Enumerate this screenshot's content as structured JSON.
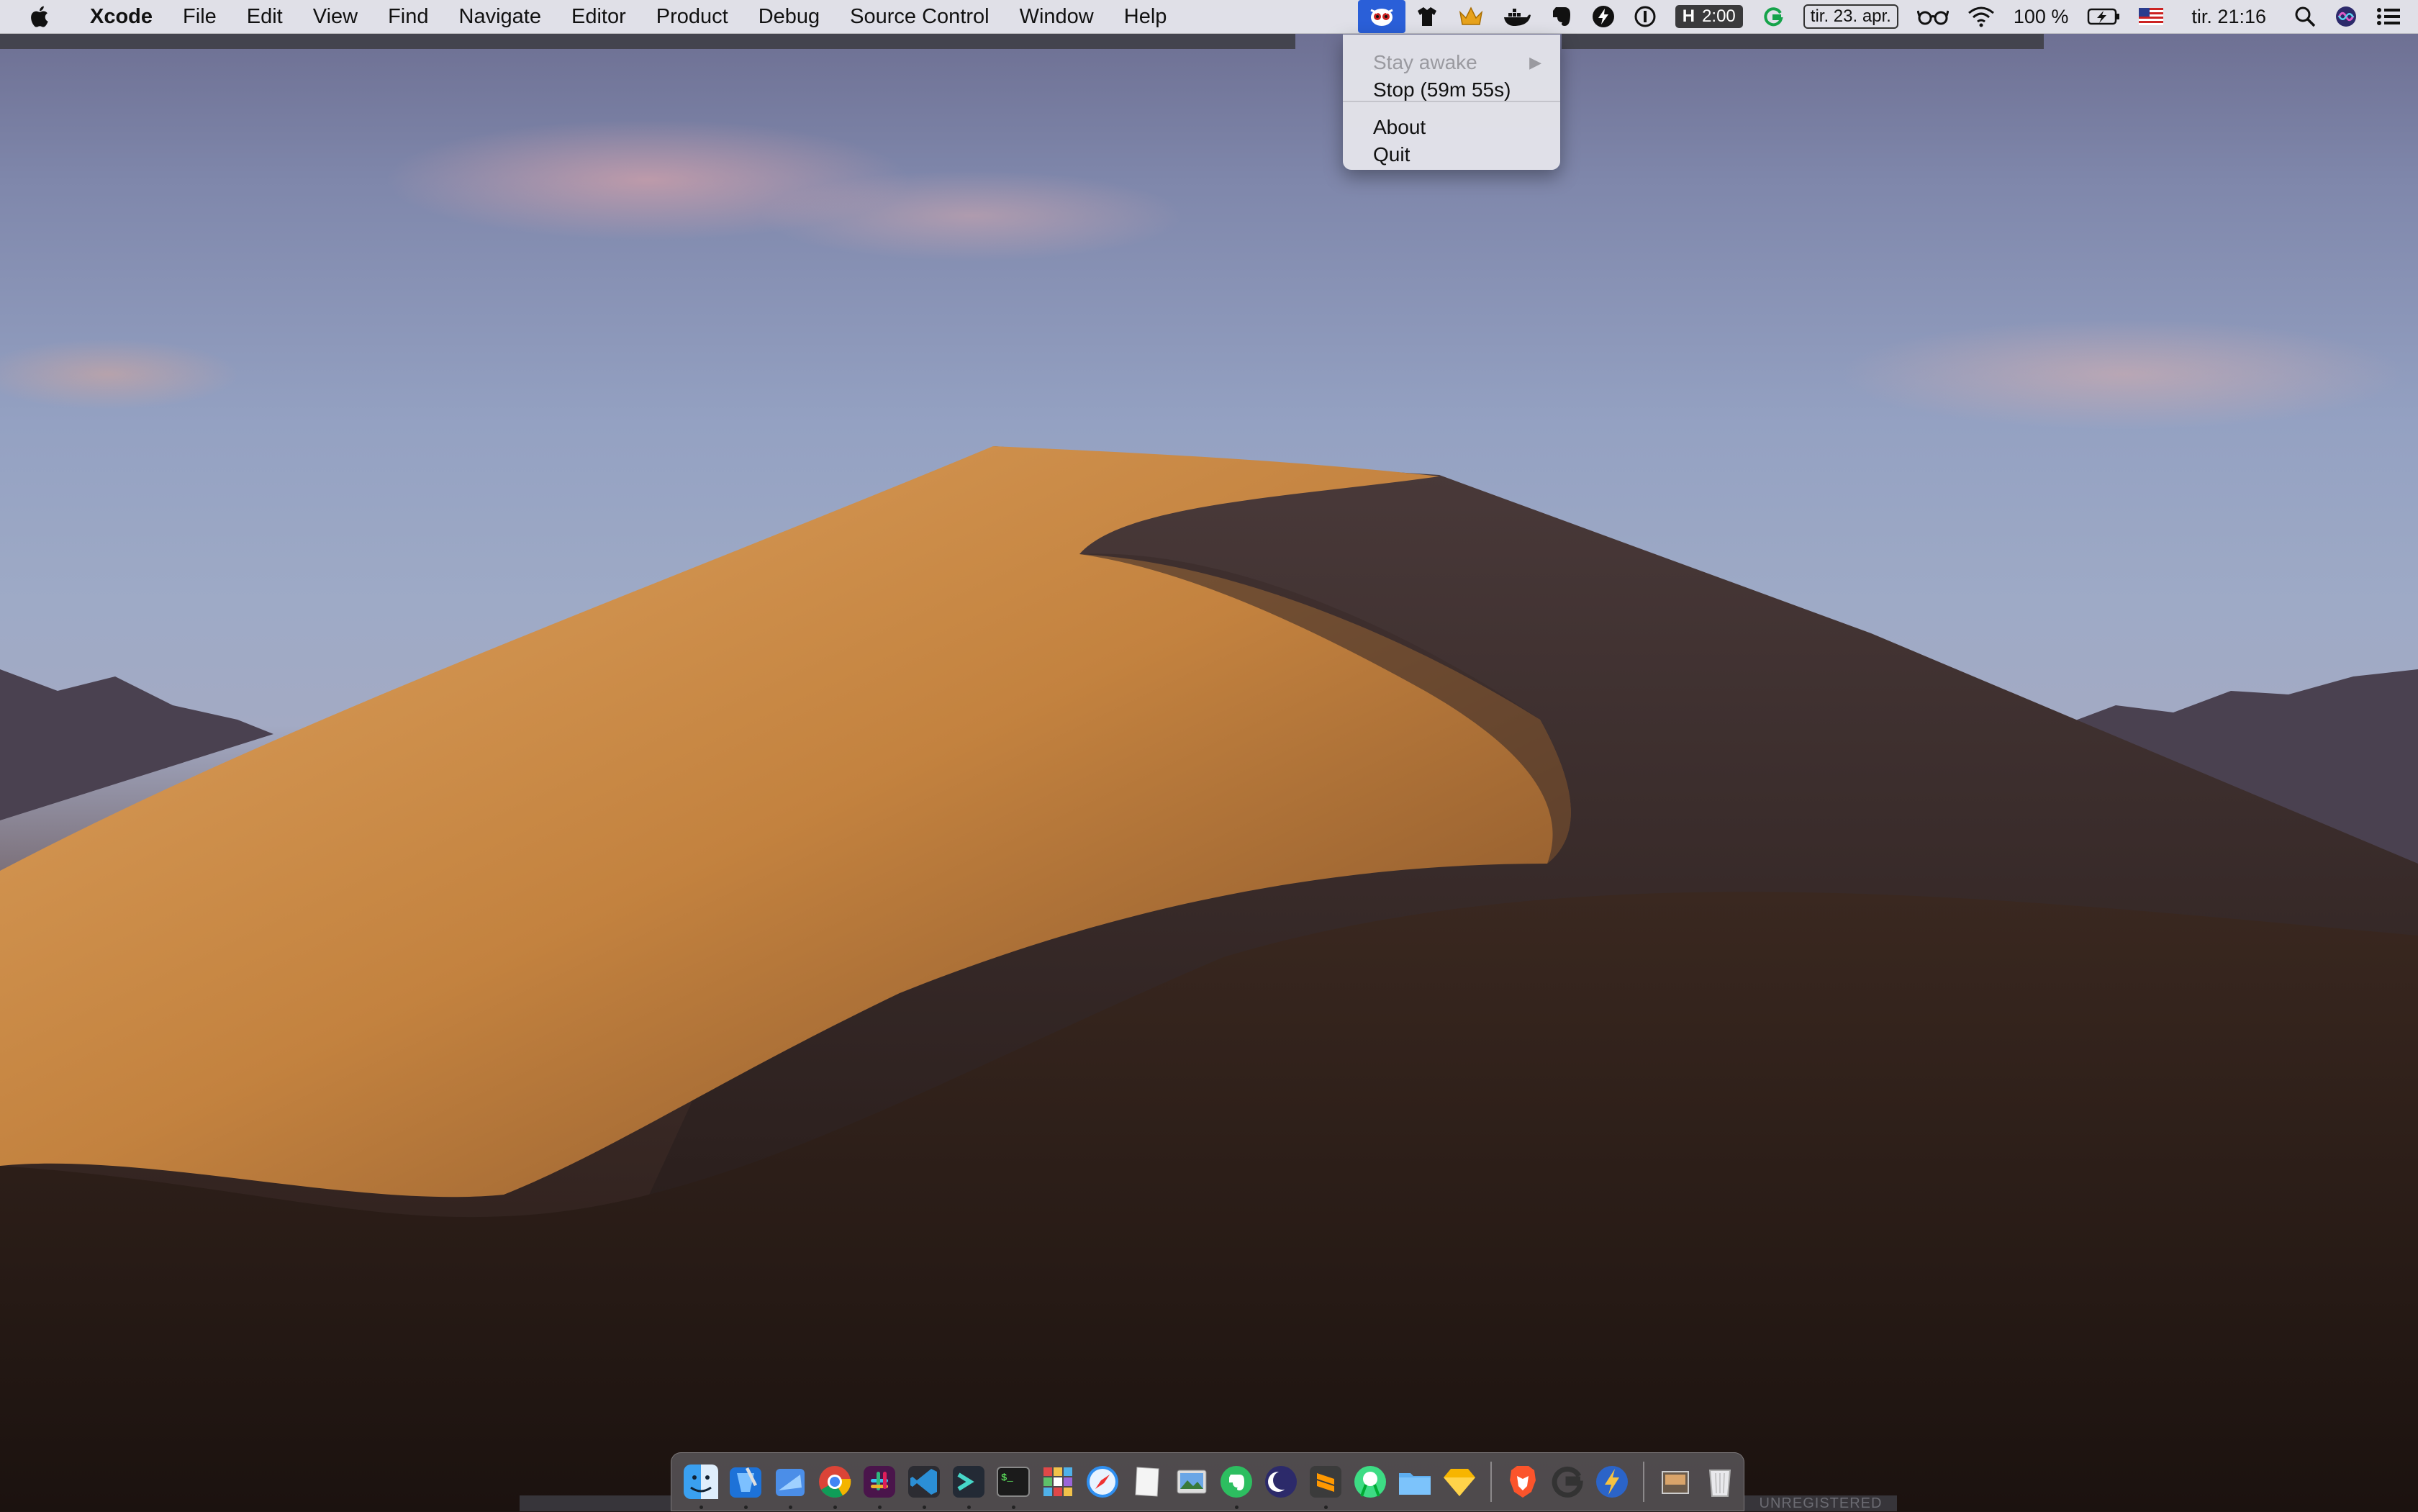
{
  "menubar": {
    "app_name": "Xcode",
    "menus": [
      "File",
      "Edit",
      "View",
      "Find",
      "Navigate",
      "Editor",
      "Product",
      "Debug",
      "Source Control",
      "Window",
      "Help"
    ]
  },
  "status_bar": {
    "timer_badge": {
      "letter": "H",
      "time": "2:00"
    },
    "date_box": "tir. 23. apr.",
    "battery": "100 %",
    "clock": "tir. 21:16",
    "items": [
      "owly-icon",
      "shirt-icon",
      "crown-icon",
      "docker-icon",
      "evernote-icon",
      "bolt-icon",
      "onepassword-icon",
      "grammarly-icon",
      "glasses-icon",
      "wifi-icon",
      "battery-icon",
      "us-flag-icon",
      "search-icon",
      "siri-icon",
      "notification-center-icon"
    ]
  },
  "dropdown": {
    "items": [
      {
        "label": "Stay awake",
        "disabled": true,
        "submenu": true
      },
      {
        "label": "Stop (59m 55s)",
        "disabled": false
      },
      {
        "label": "About",
        "disabled": false
      },
      {
        "label": "Quit",
        "disabled": false
      }
    ]
  },
  "dock": {
    "apps": [
      "finder",
      "xcode",
      "simulator",
      "chrome",
      "slack",
      "vscode",
      "prompt",
      "terminal",
      "mosaic",
      "safari",
      "textedit",
      "preview",
      "evernote",
      "eclipse",
      "sublime",
      "android-studio",
      "folder",
      "sketch",
      "brave",
      "google",
      "reeder"
    ],
    "right": [
      "downloads-stack",
      "trash"
    ]
  },
  "taskbar_label": "UNREGISTERED",
  "colors": {
    "menu_highlight": "#2a5fd8",
    "menubar_bg": "#e8e8ed"
  }
}
